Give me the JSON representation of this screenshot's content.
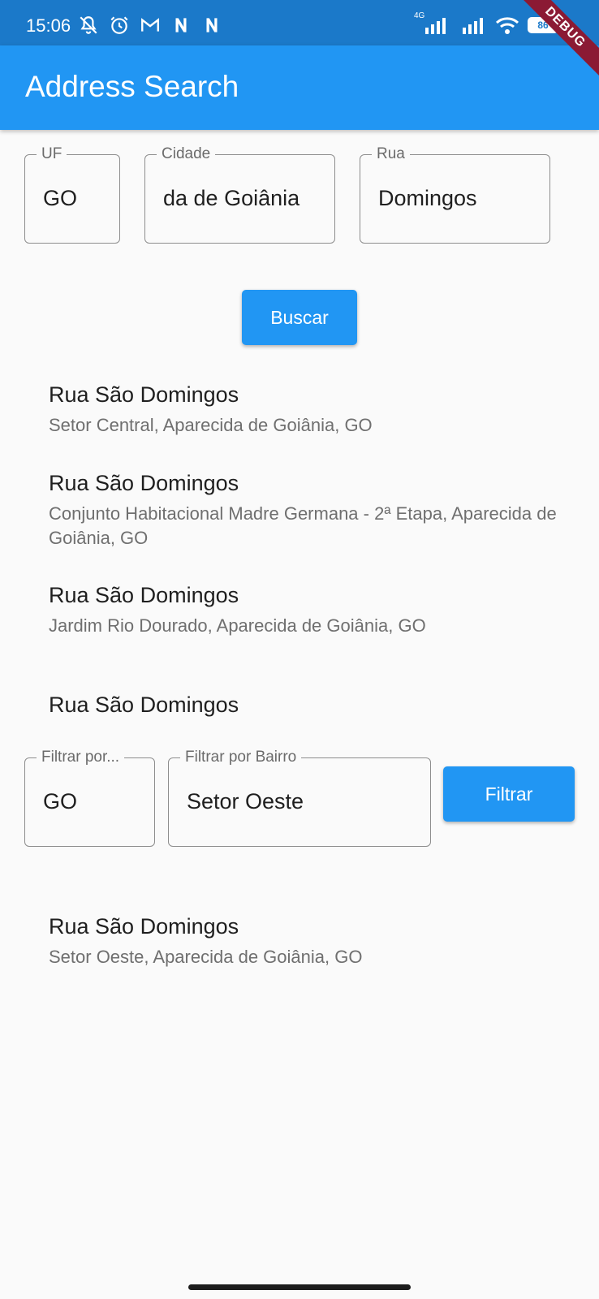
{
  "status_bar": {
    "time": "15:06",
    "battery": "86",
    "network": "4G",
    "left_icons": [
      "bell-off-icon",
      "alarm-icon",
      "gmail-icon",
      "n-icon",
      "n-icon"
    ],
    "right_icons": [
      "signal-icon",
      "signal-icon",
      "wifi-icon",
      "battery-icon"
    ]
  },
  "debug_banner": "DEBUG",
  "app_bar": {
    "title": "Address Search",
    "color": "#2196f3"
  },
  "search_form": {
    "uf": {
      "label": "UF",
      "value": "GO"
    },
    "cidade": {
      "label": "Cidade",
      "value": "da de Goiânia"
    },
    "rua": {
      "label": "Rua",
      "value": "Domingos"
    },
    "search_button": "Buscar"
  },
  "results": [
    {
      "title": "Rua São Domingos",
      "subtitle": "Setor Central, Aparecida de Goiânia, GO"
    },
    {
      "title": "Rua São Domingos",
      "subtitle": "Conjunto Habitacional Madre Germana - 2ª Etapa, Aparecida de Goiânia, GO"
    },
    {
      "title": "Rua São Domingos",
      "subtitle": "Jardim Rio Dourado, Aparecida de Goiânia, GO"
    },
    {
      "title": "Rua São Domingos"
    }
  ],
  "filter_form": {
    "estado": {
      "label": "Filtrar por...",
      "value": "GO"
    },
    "bairro": {
      "label": "Filtrar por Bairro",
      "value": "Setor Oeste"
    },
    "filter_button": "Filtrar"
  },
  "filtered_results": [
    {
      "title": "Rua São Domingos",
      "subtitle": "Setor Oeste, Aparecida de Goiânia, GO"
    }
  ]
}
